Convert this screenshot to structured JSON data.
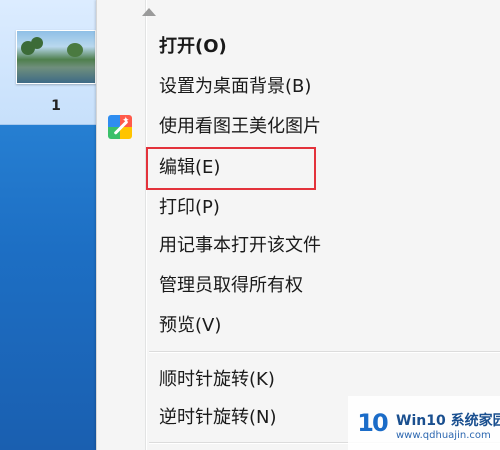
{
  "desktop": {
    "selected_item_label": "1"
  },
  "context_menu": {
    "items": [
      {
        "label": "打开(O)",
        "bold": true
      },
      {
        "label": "设置为桌面背景(B)"
      },
      {
        "label": "使用看图王美化图片",
        "icon": "kantuwang-app-icon"
      },
      {
        "label": "编辑(E)",
        "highlighted": true
      },
      {
        "label": "打印(P)"
      },
      {
        "label": "用记事本打开该文件"
      },
      {
        "label": "管理员取得所有权"
      },
      {
        "label": "预览(V)"
      },
      {
        "label": "顺时针旋转(K)"
      },
      {
        "label": "逆时针旋转(N)"
      }
    ],
    "highlight_color": "#e3323b"
  },
  "watermark": {
    "logo_text": "10",
    "title": "Win10 系统家园",
    "url": "www.qdhuajin.com"
  }
}
